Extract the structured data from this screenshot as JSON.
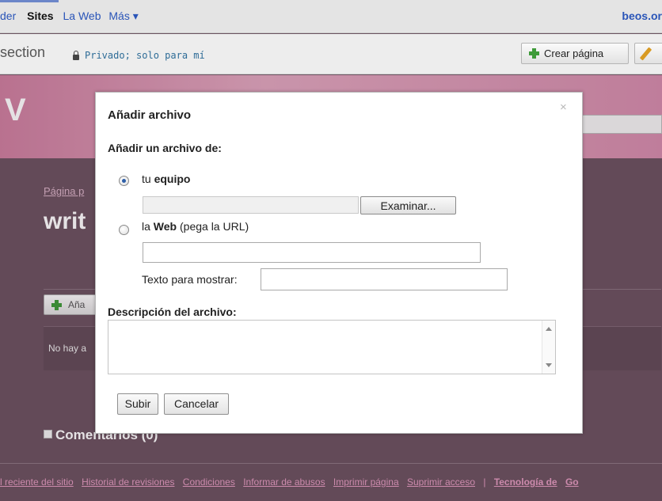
{
  "gbar": {
    "items": [
      "der",
      "Sites",
      "La Web",
      "Más ▾"
    ],
    "right": "beos.or"
  },
  "sites_bar": {
    "site_title": "section",
    "privacy": "Privado; solo para mí",
    "create_page": "Crear página"
  },
  "header": {
    "logo_letter": "V"
  },
  "page": {
    "breadcrumb": "Página p",
    "title": "writ",
    "attach_button": "Aña",
    "attach_empty": "No hay a",
    "comments": "Comentarios (0)"
  },
  "footer": {
    "links": [
      "l reciente del sitio",
      "Historial de revisiones",
      "Condiciones",
      "Informar de abusos",
      "Imprimir página",
      "Suprimir acceso"
    ],
    "separator": "|",
    "powered_prefix": "Tecnología de",
    "powered_link": "Go"
  },
  "dialog": {
    "title": "Añadir archivo",
    "close_glyph": "×",
    "subtitle": "Añadir un archivo de:",
    "option_computer_prefix": "tu",
    "option_computer_bold": "equipo",
    "browse_button": "Examinar...",
    "option_web_prefix": "la",
    "option_web_bold": "Web",
    "option_web_suffix": "(pega la URL)",
    "display_text_label": "Texto para mostrar:",
    "description_label": "Descripción del archivo:",
    "upload_button": "Subir",
    "cancel_button": "Cancelar",
    "selected_option": "tu equipo"
  },
  "colors": {
    "header_pink": "#d48dac",
    "content_bg": "#6b5360",
    "link_blue": "#2a55b8",
    "footer_link": "#e39bc0"
  }
}
